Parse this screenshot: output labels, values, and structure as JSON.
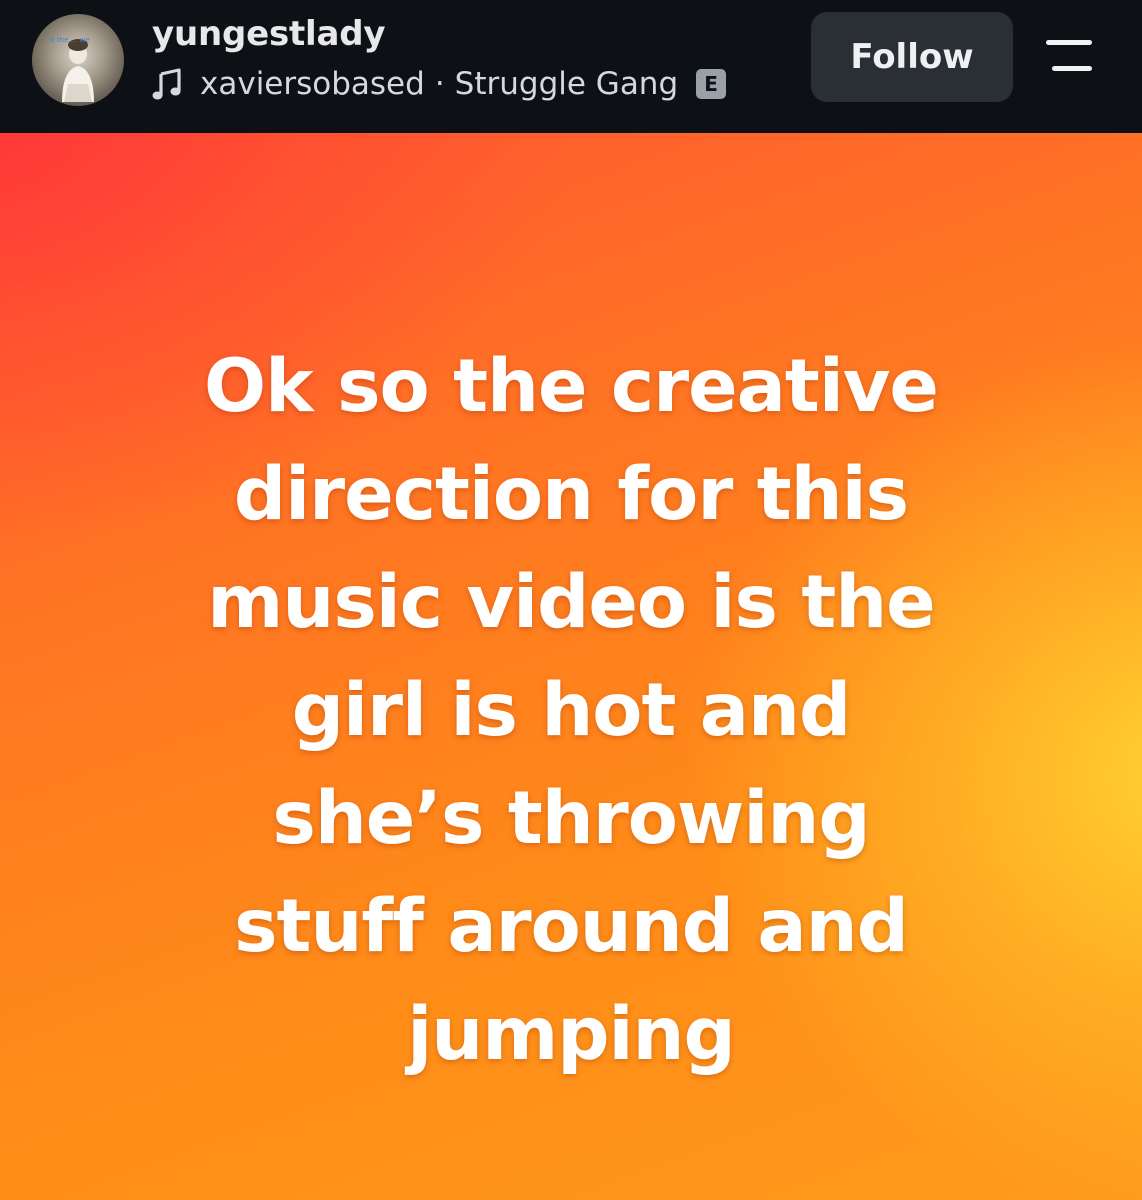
{
  "header": {
    "avatar_caption": "it the ... we",
    "username": "yungestlady",
    "music": {
      "icon": "music-note-icon",
      "artist": "xaviersobased",
      "separator": "·",
      "song": "Struggle Gang",
      "explicit_badge": "E"
    },
    "follow_label": "Follow",
    "menu_icon": "menu-icon"
  },
  "story": {
    "lines": [
      "Ok so the creative",
      "direction for this",
      "music video is the",
      "girl is hot and",
      "she’s throwing",
      "stuff around and",
      "jumping"
    ],
    "colors": {
      "gradient_red": "#ff3a3c",
      "gradient_orange": "#ff7d1c",
      "gradient_yellow": "#ffd634",
      "text": "#ffffff"
    }
  },
  "colors": {
    "header_bg": "#0d1116",
    "follow_button_bg": "#2a2f36",
    "text_primary": "#e8e8ea"
  }
}
